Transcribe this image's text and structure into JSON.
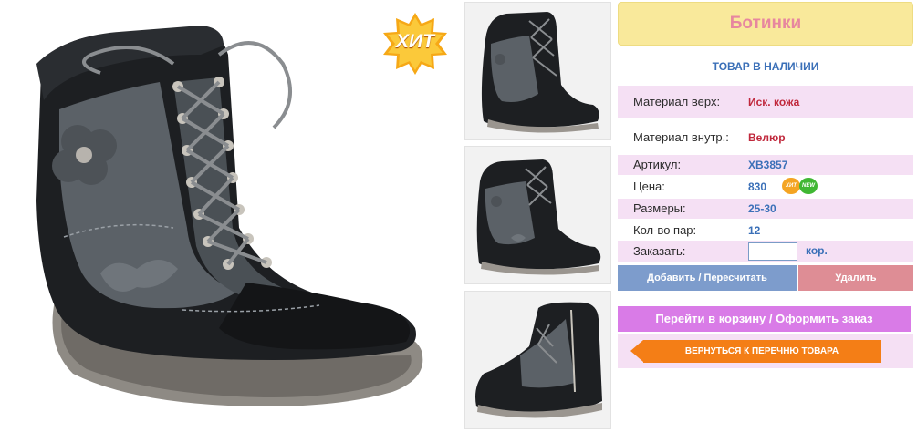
{
  "product": {
    "title": "Ботинки",
    "stock_status": "ТОВАР В НАЛИЧИИ",
    "hit_badge": "ХИТ"
  },
  "details": [
    {
      "label": "Материал верх:",
      "value": "Иск. кожа"
    },
    {
      "label": "Материал внутр.:",
      "value": "Велюр"
    },
    {
      "label": "Артикул:",
      "value": "XB3857"
    },
    {
      "label": "Цена:",
      "value": "830"
    },
    {
      "label": "Размеры:",
      "value": "25-30"
    },
    {
      "label": "Кол-во пар:",
      "value": "12"
    }
  ],
  "price_badges": {
    "hit": "ХИТ",
    "new": "NEW"
  },
  "order": {
    "label": "Заказать:",
    "quantity_value": "",
    "unit": "кор."
  },
  "buttons": {
    "add": "Добавить / Пересчитать",
    "delete": "Удалить",
    "cart": "Перейти в корзину / Оформить заказ",
    "back": "ВЕРНУТЬСЯ К ПЕРЕЧНЮ ТОВАРА"
  },
  "colors": {
    "title_bg": "#f9e99b",
    "title_text": "#e7879f",
    "accent_blue": "#3b70b8",
    "accent_red": "#c0283c",
    "row_pink": "#f5e0f4",
    "btn_add": "#7d9ccc",
    "btn_delete": "#de8d95",
    "btn_cart": "#d97be7",
    "btn_back": "#f47e16"
  },
  "images": {
    "main": "boot-photo-main",
    "thumbnails": [
      "boot-photo-front",
      "boot-photo-side",
      "boot-photo-zipper"
    ]
  }
}
